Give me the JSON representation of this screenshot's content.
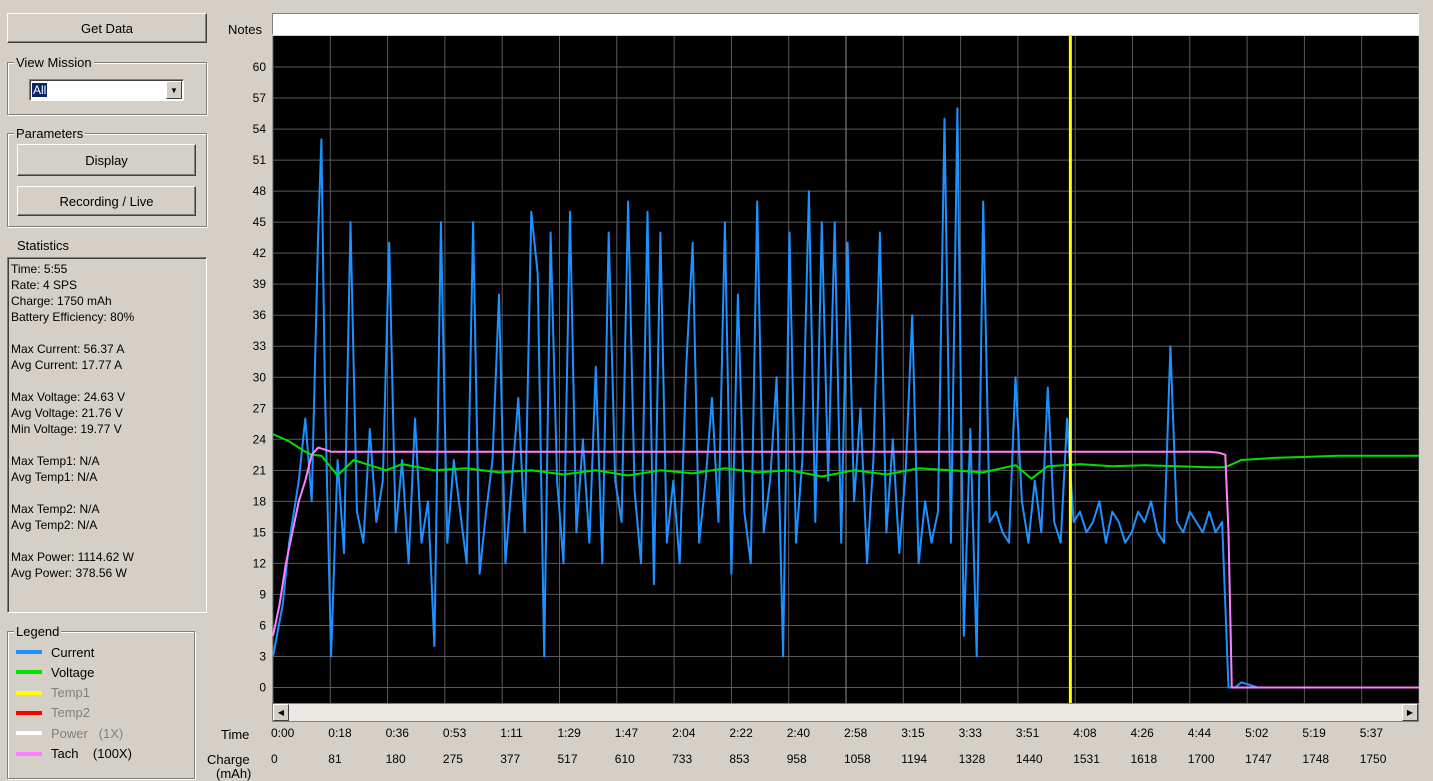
{
  "buttons": {
    "get_data": "Get Data",
    "display": "Display",
    "recording_live": "Recording / Live"
  },
  "view_mission": {
    "label": "View Mission",
    "selected": "All"
  },
  "parameters": {
    "label": "Parameters"
  },
  "statistics": {
    "label": "Statistics",
    "lines": [
      "Time: 5:55",
      "Rate: 4 SPS",
      "Charge: 1750 mAh",
      "Battery Efficiency: 80%",
      "",
      "Max Current: 56.37 A",
      "Avg Current: 17.77 A",
      "",
      "Max Voltage: 24.63 V",
      "Avg Voltage: 21.76 V",
      "Min Voltage: 19.77 V",
      "",
      "Max Temp1: N/A",
      "Avg Temp1: N/A",
      "",
      "Max Temp2: N/A",
      "Avg Temp2: N/A",
      "",
      "Max Power: 1114.62 W",
      "Avg Power: 378.56 W"
    ]
  },
  "legend": {
    "label": "Legend",
    "items": [
      {
        "label": "Current",
        "color": "#1e90ff",
        "enabled": true
      },
      {
        "label": "Voltage",
        "color": "#00e000",
        "enabled": true
      },
      {
        "label": "Temp1",
        "color": "#ffff00",
        "enabled": false
      },
      {
        "label": "Temp2",
        "color": "#ff0000",
        "enabled": false
      },
      {
        "label": "Power   (1X)",
        "color": "#ffffff",
        "enabled": false
      },
      {
        "label": "Tach    (100X)",
        "color": "#ff80ff",
        "enabled": true
      }
    ]
  },
  "notes": {
    "label": "Notes",
    "value": ""
  },
  "axis_rows": {
    "time_label": "Time",
    "charge_label": "Charge\n(mAh)"
  },
  "chart_data": {
    "type": "line",
    "background": "#000000",
    "grid": true,
    "y_ticks": [
      0,
      3,
      6,
      9,
      12,
      15,
      18,
      21,
      24,
      27,
      30,
      33,
      36,
      39,
      42,
      45,
      48,
      51,
      54,
      57,
      60
    ],
    "ylim": [
      -1.5,
      63
    ],
    "xlim": [
      0,
      355
    ],
    "time_ticks": [
      "0:00",
      "0:18",
      "0:36",
      "0:53",
      "1:11",
      "1:29",
      "1:47",
      "2:04",
      "2:22",
      "2:40",
      "2:58",
      "3:15",
      "3:33",
      "3:51",
      "4:08",
      "4:26",
      "4:44",
      "5:02",
      "5:19",
      "5:37"
    ],
    "charge_ticks": [
      "0",
      "81",
      "180",
      "275",
      "377",
      "517",
      "610",
      "733",
      "853",
      "958",
      "1058",
      "1194",
      "1328",
      "1440",
      "1531",
      "1618",
      "1700",
      "1747",
      "1748",
      "1750"
    ],
    "cursor_time_s": 247,
    "series": [
      {
        "name": "Current",
        "color": "#1e90ff",
        "x": [
          0,
          3,
          5,
          8,
          10,
          12,
          14,
          15,
          16,
          17,
          18,
          20,
          22,
          24,
          26,
          28,
          30,
          32,
          34,
          36,
          38,
          40,
          42,
          44,
          46,
          48,
          50,
          52,
          54,
          56,
          58,
          60,
          62,
          64,
          66,
          68,
          70,
          72,
          74,
          76,
          78,
          80,
          82,
          84,
          86,
          88,
          90,
          92,
          94,
          96,
          98,
          100,
          102,
          104,
          106,
          108,
          110,
          112,
          114,
          116,
          118,
          120,
          122,
          124,
          126,
          128,
          130,
          132,
          134,
          136,
          138,
          140,
          142,
          144,
          146,
          148,
          150,
          152,
          154,
          156,
          158,
          160,
          162,
          164,
          166,
          168,
          170,
          172,
          174,
          176,
          178,
          180,
          182,
          184,
          186,
          188,
          190,
          192,
          194,
          196,
          198,
          200,
          202,
          204,
          206,
          208,
          210,
          212,
          214,
          216,
          218,
          220,
          222,
          224,
          226,
          228,
          230,
          232,
          234,
          236,
          238,
          240,
          242,
          244,
          246,
          248,
          250,
          252,
          254,
          256,
          258,
          260,
          262,
          264,
          266,
          268,
          270,
          272,
          274,
          276,
          278,
          280,
          282,
          284,
          286,
          288,
          290,
          292,
          294,
          296,
          298,
          300,
          305,
          310,
          320,
          330,
          340,
          350,
          355
        ],
        "y": [
          3,
          8,
          14,
          20,
          26,
          18,
          44,
          53,
          30,
          16,
          3,
          22,
          13,
          45,
          17,
          14,
          25,
          16,
          20,
          43,
          15,
          22,
          12,
          26,
          14,
          18,
          4,
          45,
          14,
          22,
          17,
          12,
          45,
          11,
          17,
          22,
          38,
          12,
          20,
          28,
          15,
          46,
          40,
          3,
          44,
          20,
          12,
          46,
          15,
          24,
          14,
          31,
          12,
          44,
          20,
          16,
          47,
          19,
          12,
          46,
          10,
          44,
          14,
          20,
          12,
          31,
          43,
          14,
          20,
          28,
          16,
          45,
          11,
          38,
          17,
          12,
          47,
          15,
          20,
          30,
          3,
          44,
          14,
          22,
          48,
          16,
          45,
          20,
          45,
          14,
          43,
          18,
          27,
          12,
          22,
          44,
          15,
          24,
          13,
          21,
          36,
          12,
          18,
          14,
          17,
          55,
          14,
          56,
          5,
          25,
          3,
          47,
          16,
          17,
          15,
          14,
          30,
          18,
          14,
          20,
          15,
          29,
          16,
          14,
          26,
          16,
          17,
          15,
          16,
          18,
          14,
          17,
          16,
          14,
          15,
          17,
          16,
          18,
          15,
          14,
          33,
          16,
          15,
          17,
          16,
          15,
          17,
          15,
          16,
          0,
          0,
          0.5,
          0,
          0,
          0,
          0,
          0,
          0,
          0
        ]
      },
      {
        "name": "Voltage",
        "color": "#00e000",
        "x": [
          0,
          5,
          8,
          10,
          12,
          15,
          20,
          25,
          30,
          35,
          40,
          50,
          60,
          70,
          80,
          90,
          100,
          110,
          120,
          130,
          140,
          150,
          160,
          170,
          180,
          190,
          200,
          210,
          220,
          230,
          235,
          240,
          245,
          250,
          260,
          270,
          280,
          290,
          295,
          300,
          310,
          320,
          330,
          340,
          355
        ],
        "y": [
          24.5,
          23.8,
          23.2,
          22.8,
          22.5,
          22.4,
          20.5,
          22,
          21.5,
          21,
          21.6,
          21,
          21.2,
          20.8,
          21,
          20.6,
          21,
          20.5,
          21,
          20.7,
          21.2,
          20.8,
          21,
          20.4,
          21,
          20.6,
          21.2,
          21,
          20.8,
          21.5,
          20.2,
          21.4,
          21.5,
          21.6,
          21.4,
          21.5,
          21.4,
          21.3,
          21.3,
          22,
          22.2,
          22.3,
          22.4,
          22.4,
          22.4
        ]
      },
      {
        "name": "Tach    (100X)",
        "color": "#ff80ff",
        "x": [
          0,
          2,
          4,
          6,
          8,
          10,
          12,
          14,
          16,
          18,
          20,
          290,
          293,
          295,
          296,
          297,
          300,
          305,
          310,
          355
        ],
        "y": [
          5,
          8,
          12,
          15,
          18,
          20,
          22.5,
          23.2,
          23,
          22.8,
          22.8,
          22.8,
          22.7,
          22.5,
          15,
          0,
          0,
          0,
          0,
          0
        ]
      }
    ]
  }
}
